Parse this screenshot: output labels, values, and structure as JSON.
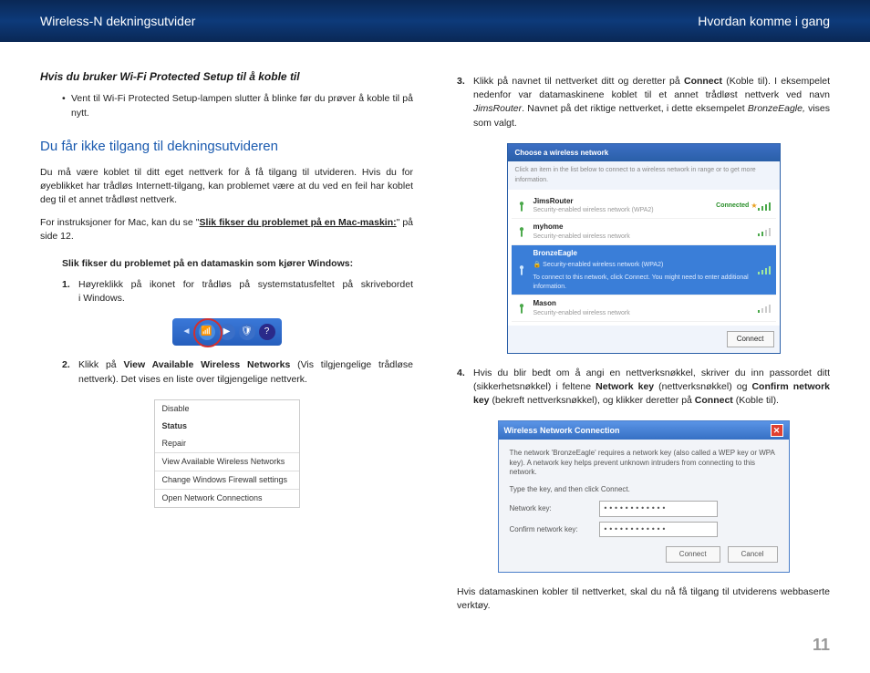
{
  "header": {
    "left": "Wireless-N dekningsutvider",
    "right": "Hvordan komme i gang"
  },
  "left": {
    "h3": "Hvis du bruker Wi-Fi Protected Setup til å koble til",
    "bullet": "Vent til Wi-Fi Protected Setup-lampen slutter å blinke før du prøver å koble til på nytt.",
    "h2": "Du får ikke tilgang til dekningsutvideren",
    "p1": "Du må være koblet til ditt eget nettverk for å få tilgang til utvideren. Hvis du for øyeblikket har trådløs Internett-tilgang, kan problemet være at du ved en feil har koblet deg til et annet trådløst nettverk.",
    "p2a": "For instruksjoner for Mac, kan du se \"",
    "p2link": "Slik fikser du problemet på en Mac-maskin:",
    "p2b": "\" på side 12.",
    "stepH": "Slik fikser du problemet på en datamaskin som kjører Windows:",
    "s1": "Høyreklikk på ikonet for trådløs på systemstatusfeltet på skrivebordet i Windows.",
    "s2a": "Klikk på ",
    "s2b": "View Available Wireless Networks",
    "s2c": " (Vis tilgjengelige trådløse nettverk). Det vises en liste over tilgjengelige nettverk.",
    "menu": {
      "disable": "Disable",
      "status": "Status",
      "repair": "Repair",
      "view": "View Available Wireless Networks",
      "firewall": "Change Windows Firewall settings",
      "open": "Open Network Connections"
    }
  },
  "right": {
    "s3a": "Klikk på navnet til nettverket ditt og deretter på ",
    "s3b": "Connect",
    "s3c": " (Koble til). I eksempelet nedenfor var datamaskinene koblet til et annet trådløst nettverk ved navn ",
    "s3d": "JimsRouter",
    "s3e": ". Navnet på det riktige nettverket, i dette eksempelet ",
    "s3f": "BronzeEagle,",
    "s3g": " vises som valgt.",
    "wifi": {
      "title": "Choose a wireless network",
      "sub": "Click an item in the list below to connect to a wireless network in range or to get more information.",
      "n1": "JimsRouter",
      "n1s": "Security-enabled wireless network (WPA2)",
      "n1c": "Connected",
      "n2": "myhome",
      "n2s": "Security-enabled wireless network",
      "n3": "BronzeEagle",
      "n3s1": "Security-enabled wireless network (WPA2)",
      "n3s2": "To connect to this network, click Connect. You might need to enter additional information.",
      "n4": "Mason",
      "n4s": "Security-enabled wireless network",
      "connect": "Connect"
    },
    "s4a": "Hvis du blir bedt om å angi en nettverksnøkkel, skriver du inn passordet ditt (sikkerhetsnøkkel) i feltene ",
    "s4b": "Network key",
    "s4c": " (nettverksnøkkel) og ",
    "s4d": "Confirm network key",
    "s4e": " (bekreft nettverksnøkkel), og klikker deretter på ",
    "s4f": "Connect",
    "s4g": " (Koble til).",
    "dlg": {
      "title": "Wireless Network Connection",
      "desc": "The network 'BronzeEagle' requires a network key (also called a WEP key or WPA key). A network key helps prevent unknown intruders from connecting to this network.",
      "instr": "Type the key, and then click Connect.",
      "l1": "Network key:",
      "l2": "Confirm network key:",
      "v": "••••••••••••",
      "connect": "Connect",
      "cancel": "Cancel"
    },
    "conclusion": "Hvis datamaskinen kobler til nettverket, skal du nå få tilgang til utviderens webbaserte verktøy."
  },
  "pagenum": "11"
}
